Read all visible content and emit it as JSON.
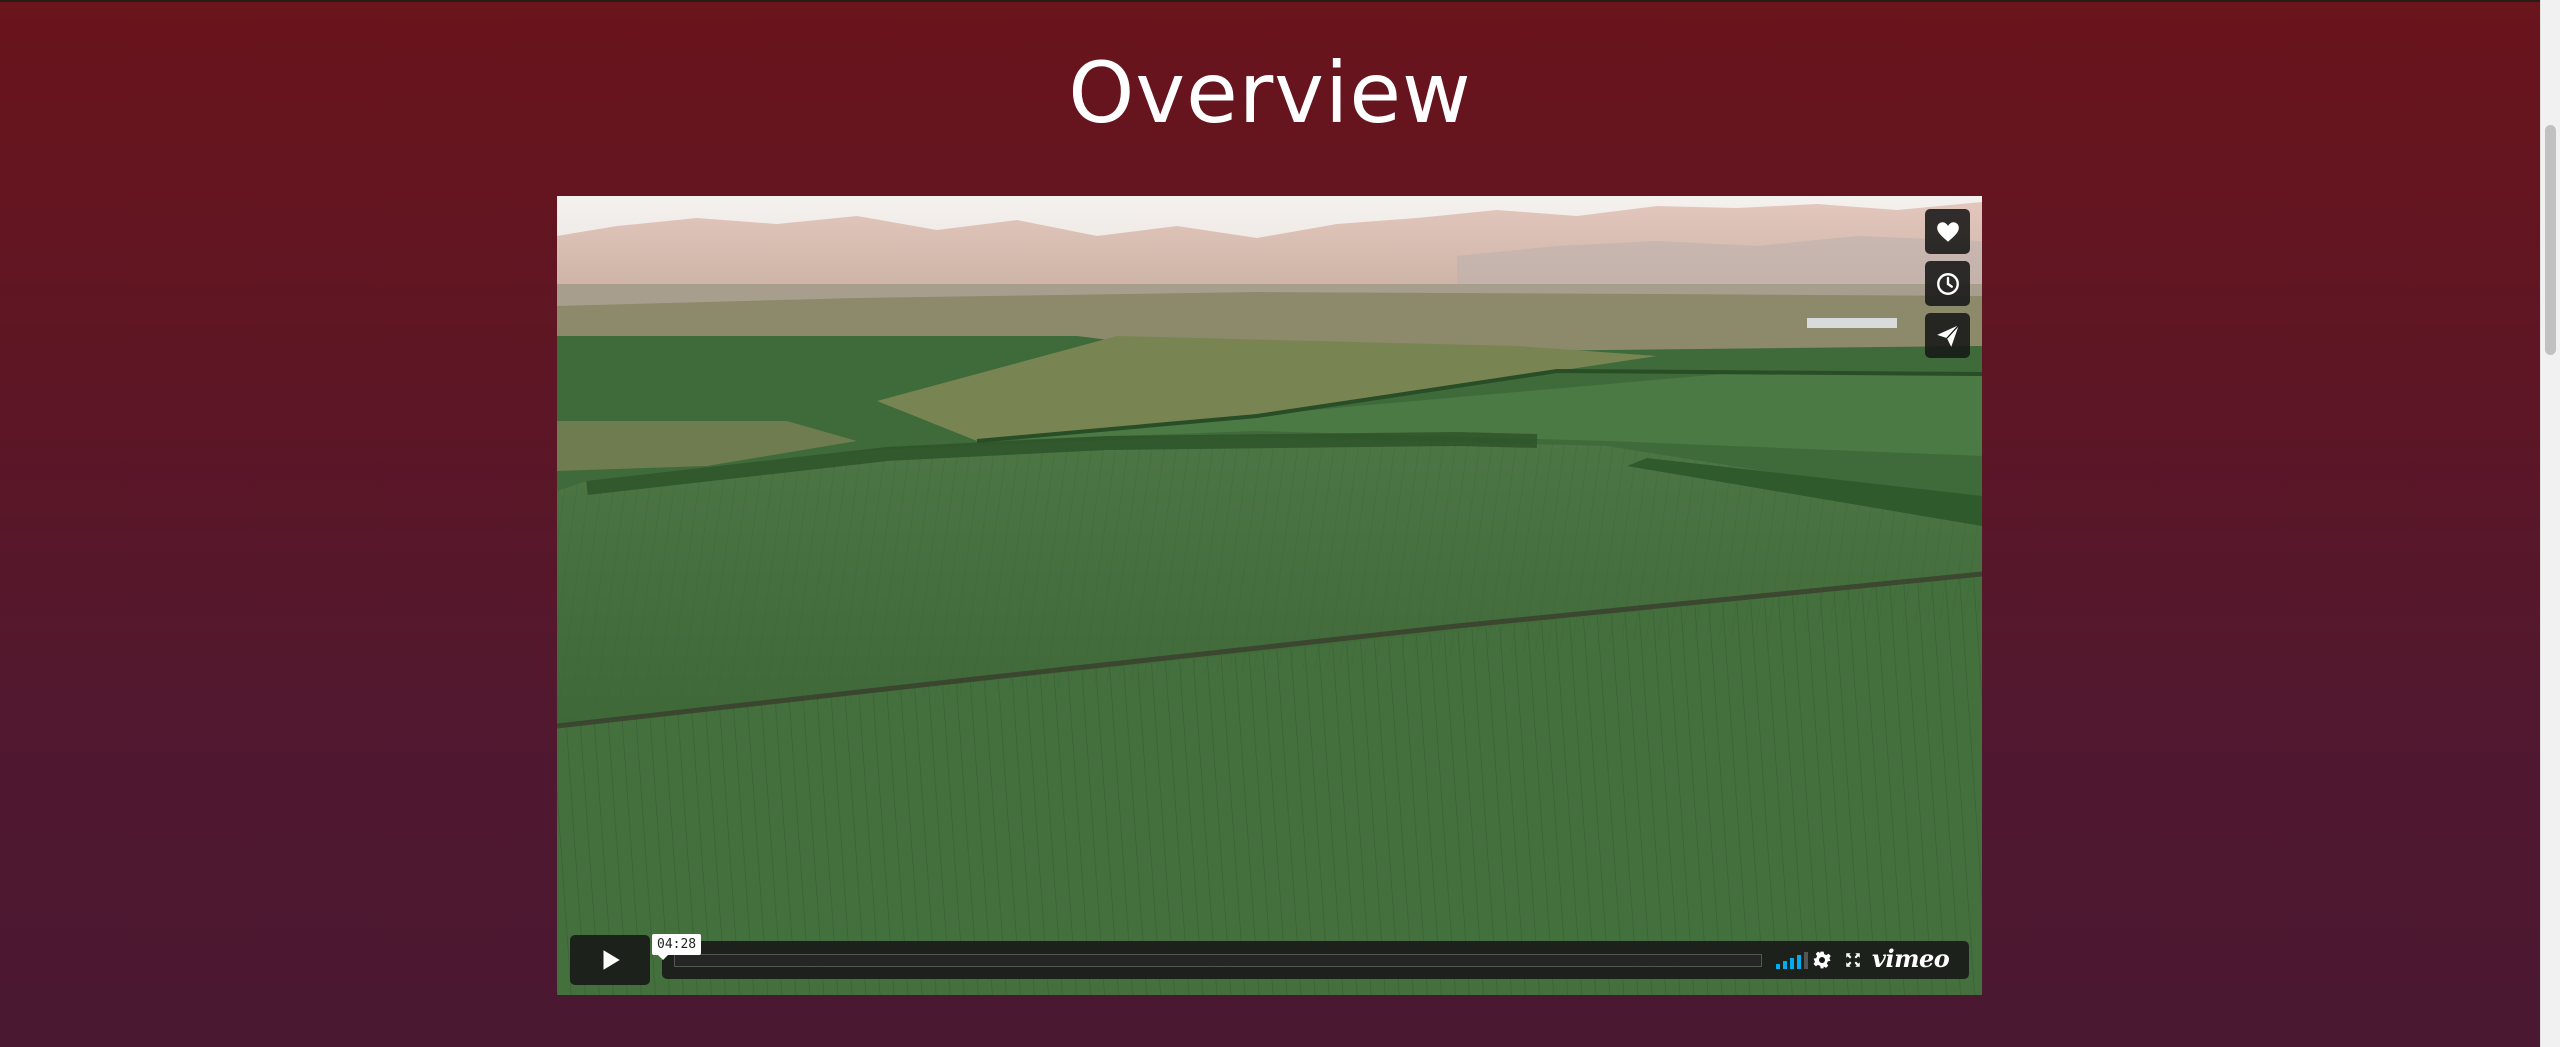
{
  "section": {
    "title": "Overview"
  },
  "video": {
    "scene": "aerial-farm-fields",
    "side_actions": [
      {
        "icon": "heart-icon",
        "label": "Like"
      },
      {
        "icon": "clock-icon",
        "label": "Watch Later"
      },
      {
        "icon": "paper-plane-icon",
        "label": "Share"
      }
    ],
    "duration": "04:28",
    "progress": 0,
    "quality_bars_active": 4,
    "brand": "vimeo",
    "accent_color": "#00adef"
  },
  "page": {
    "background_top": "#6a141c",
    "background_bottom": "#4a1831"
  }
}
